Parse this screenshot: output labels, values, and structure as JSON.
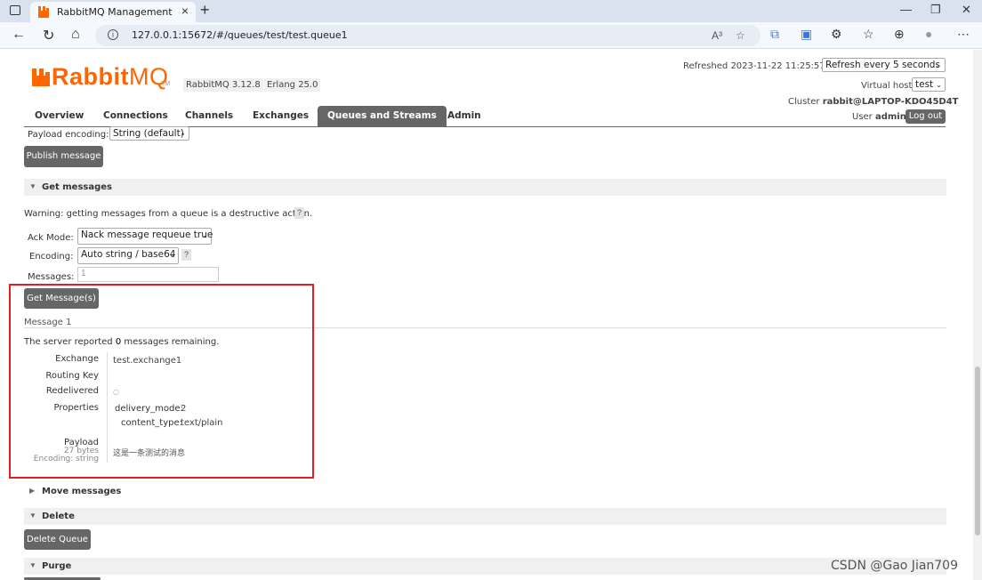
{
  "browser": {
    "tab_title": "RabbitMQ Management",
    "url": "127.0.0.1:15672/#/queues/test/test.queue1",
    "read_aloud": "A³"
  },
  "header": {
    "logo_rabbit": "Rabbit",
    "logo_mq": "MQ",
    "logo_tm": "TM",
    "version_rabbitmq": "RabbitMQ 3.12.8",
    "version_erlang": "Erlang 25.0",
    "refreshed_label": "Refreshed 2023-11-22 11:25:57",
    "refresh_select": "Refresh every 5 seconds",
    "vhost_label": "Virtual host",
    "vhost_select": "test",
    "cluster_label": "Cluster",
    "cluster_name": "rabbit@LAPTOP-KDO45D4T",
    "user_label": "User",
    "user_name": "admin",
    "logout": "Log out"
  },
  "nav": {
    "overview": "Overview",
    "connections": "Connections",
    "channels": "Channels",
    "exchanges": "Exchanges",
    "queues": "Queues and Streams",
    "admin": "Admin"
  },
  "publish": {
    "payload_encoding_label": "Payload encoding:",
    "payload_encoding_value": "String (default)",
    "publish_button": "Publish message"
  },
  "get_messages": {
    "title": "Get messages",
    "warning": "Warning: getting messages from a queue is a destructive action.",
    "ack_mode_label": "Ack Mode:",
    "ack_mode_value": "Nack message requeue true",
    "encoding_label": "Encoding:",
    "encoding_value": "Auto string / base64",
    "messages_label": "Messages:",
    "messages_value": "1",
    "get_button": "Get Message(s)",
    "help": "?"
  },
  "result": {
    "message_heading": "Message 1",
    "server_reported_prefix": "The server reported ",
    "remaining_count": "0",
    "server_reported_suffix": " messages remaining.",
    "exchange_label": "Exchange",
    "exchange_value": "test.exchange1",
    "routing_key_label": "Routing Key",
    "routing_key_value": "",
    "redelivered_label": "Redelivered",
    "redelivered_value": "○",
    "properties_label": "Properties",
    "delivery_mode_key": "delivery_mode:",
    "delivery_mode_value": "2",
    "content_type_key": "content_type:",
    "content_type_value": "text/plain",
    "payload_label": "Payload",
    "payload_size": "27 bytes",
    "payload_encoding": "Encoding: string",
    "payload_value": "这是一条测试的消息"
  },
  "sections": {
    "move": "Move messages",
    "delete": "Delete",
    "delete_button": "Delete Queue",
    "purge": "Purge"
  },
  "watermark": "CSDN @Gao Jian709",
  "colors": {
    "brand": "#ff6600",
    "button": "#666666",
    "highlight_box": "#e02020"
  }
}
